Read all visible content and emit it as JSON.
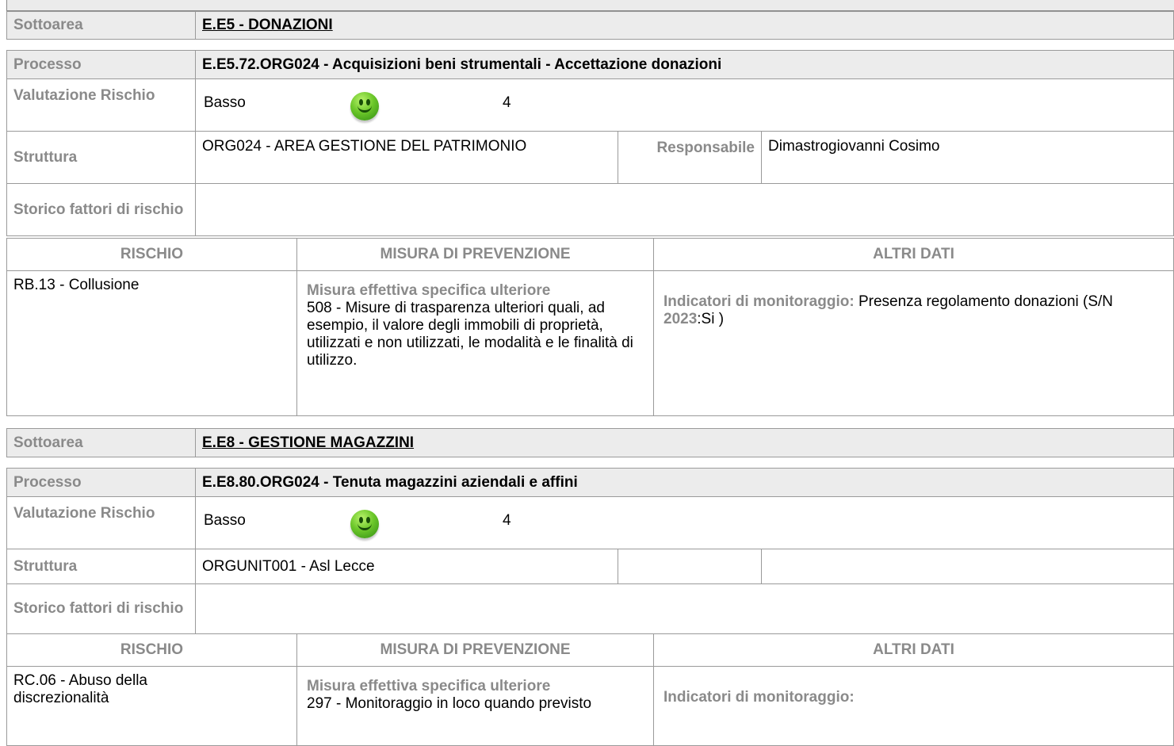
{
  "labels": {
    "sottoarea": "Sottoarea",
    "processo": "Processo",
    "valutazione": "Valutazione Rischio",
    "struttura": "Struttura",
    "responsabile": "Responsabile",
    "storico": "Storico fattori di rischio",
    "col_rischio": "RISCHIO",
    "col_misura": "MISURA DI PREVENZIONE",
    "col_altri": "ALTRI DATI",
    "misura_tipo": "Misura effettiva specifica ulteriore",
    "indicatori": "Indicatori di monitoraggio:"
  },
  "blocks": [
    {
      "sottoarea": "E.E5 - DONAZIONI",
      "processo": "E.E5.72.ORG024 - Acquisizioni beni strumentali - Accettazione donazioni",
      "rischio_livello": "Basso",
      "rischio_icon": "green-smiley-icon",
      "rischio_valore": "4",
      "struttura": "ORG024 - AREA GESTIONE DEL PATRIMONIO",
      "responsabile_label": "Responsabile",
      "responsabile": "Dimastrogiovanni Cosimo",
      "storico": "",
      "rischio": "RB.13 - Collusione",
      "misura": "508 - Misure di trasparenza ulteriori quali, ad esempio, il valore degli immobili di proprietà, utilizzati e non utilizzati, le modalità e le finalità di utilizzo.",
      "indicatore_testo": "Presenza regolamento donazioni (S/N ",
      "indicatore_anno": "2023",
      "indicatore_valore": ":Si  )"
    },
    {
      "sottoarea": "E.E8 - GESTIONE MAGAZZINI",
      "processo": "E.E8.80.ORG024 - Tenuta magazzini aziendali e affini",
      "rischio_livello": "Basso",
      "rischio_icon": "green-smiley-icon",
      "rischio_valore": "4",
      "struttura": "ORGUNIT001 - Asl Lecce",
      "responsabile_label": "",
      "responsabile": "",
      "storico": "",
      "rischio": "RC.06 - Abuso della discrezionalità",
      "misura": "297 - Monitoraggio in loco quando previsto",
      "indicatore_testo": "",
      "indicatore_anno": "",
      "indicatore_valore": ""
    }
  ]
}
